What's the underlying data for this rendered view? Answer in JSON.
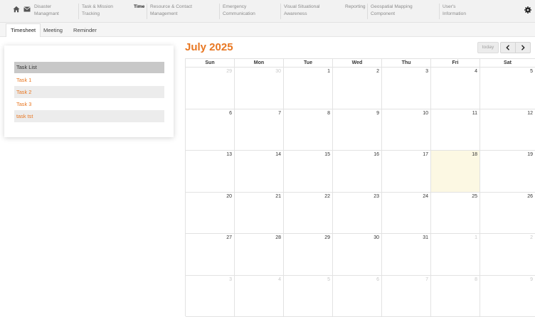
{
  "nav": {
    "items": [
      {
        "label": "Disaster\nManagmant",
        "active": false
      },
      {
        "label": "Task & Mission\nTracking",
        "active": false
      },
      {
        "label": "Time",
        "active": true
      },
      {
        "label": "Resource & Contact\nManagement",
        "active": false
      },
      {
        "label": "Emergency\nCommunication",
        "active": false
      },
      {
        "label": "Visual Situational\nAwareness",
        "active": false
      },
      {
        "label": "Reporting",
        "active": false
      },
      {
        "label": "Geospatial Mapping\nComponent",
        "active": false
      },
      {
        "label": "User's\nInformation",
        "active": false
      }
    ],
    "icons": [
      "home-icon",
      "mail-icon",
      "gear-icon"
    ]
  },
  "tabs": [
    "Timesheet",
    "Meeting",
    "Reminder"
  ],
  "active_tab": "Timesheet",
  "tasks": {
    "header": "Task List",
    "items": [
      "Task 1",
      "Task 2",
      "Task 3",
      "task tst"
    ]
  },
  "calendar": {
    "title": "July 2025",
    "today_label": "today",
    "today_date": 18,
    "weekdays": [
      "Sun",
      "Mon",
      "Tue",
      "Wed",
      "Thu",
      "Fri",
      "Sat"
    ],
    "weeks": [
      [
        29,
        30,
        1,
        2,
        3,
        4,
        5
      ],
      [
        6,
        7,
        8,
        9,
        10,
        11,
        12
      ],
      [
        13,
        14,
        15,
        16,
        17,
        18,
        19
      ],
      [
        20,
        21,
        22,
        23,
        24,
        25,
        26
      ],
      [
        27,
        28,
        29,
        30,
        31,
        1,
        2
      ],
      [
        3,
        4,
        5,
        6,
        7,
        8,
        9
      ]
    ],
    "accent": "#e87722",
    "today_color": "#fcf8e3"
  }
}
